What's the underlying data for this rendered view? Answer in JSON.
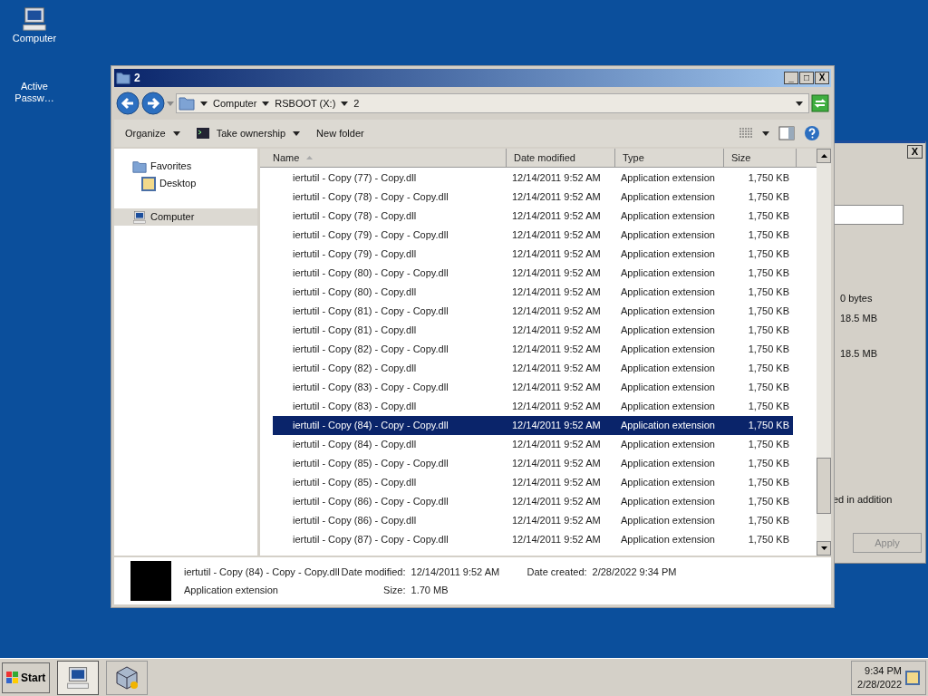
{
  "desktop_icons": [
    {
      "label": "Computer",
      "kind": "computer"
    },
    {
      "label": "Active Passw…",
      "kind": "blank"
    }
  ],
  "background_dialog": {
    "values": [
      "0 bytes",
      "18.5 MB",
      "18.5 MB"
    ],
    "note": "ed in addition",
    "apply_button": "Apply",
    "close_button": "X"
  },
  "window": {
    "title": "2",
    "controls": [
      "_",
      "□",
      "X"
    ]
  },
  "address_bar": {
    "breadcrumbs": [
      "Computer",
      "RSBOOT (X:)",
      "2"
    ]
  },
  "toolbar": [
    {
      "label": "Organize",
      "kind": "menu"
    },
    {
      "label": "Take ownership",
      "kind": "icon-menu"
    },
    {
      "label": "New folder",
      "kind": "plain"
    }
  ],
  "nav_pane": [
    {
      "label": "Favorites",
      "kind": "folder",
      "selected": false,
      "children": [
        {
          "label": "Desktop",
          "kind": "desktop",
          "selected": false
        }
      ]
    },
    {
      "label": "Computer",
      "kind": "computer",
      "selected": true
    }
  ],
  "table": {
    "columns": [
      "Name",
      "Date modified",
      "Type",
      "Size"
    ],
    "rows": [
      {
        "name": "iertutil - Copy (77) - Copy.dll",
        "date": "12/14/2011 9:52 AM",
        "type": "Application extension",
        "size": "1,750 KB",
        "selected": false
      },
      {
        "name": "iertutil - Copy (78) - Copy - Copy.dll",
        "date": "12/14/2011 9:52 AM",
        "type": "Application extension",
        "size": "1,750 KB",
        "selected": false
      },
      {
        "name": "iertutil - Copy (78) - Copy.dll",
        "date": "12/14/2011 9:52 AM",
        "type": "Application extension",
        "size": "1,750 KB",
        "selected": false
      },
      {
        "name": "iertutil - Copy (79) - Copy - Copy.dll",
        "date": "12/14/2011 9:52 AM",
        "type": "Application extension",
        "size": "1,750 KB",
        "selected": false
      },
      {
        "name": "iertutil - Copy (79) - Copy.dll",
        "date": "12/14/2011 9:52 AM",
        "type": "Application extension",
        "size": "1,750 KB",
        "selected": false
      },
      {
        "name": "iertutil - Copy (80) - Copy - Copy.dll",
        "date": "12/14/2011 9:52 AM",
        "type": "Application extension",
        "size": "1,750 KB",
        "selected": false
      },
      {
        "name": "iertutil - Copy (80) - Copy.dll",
        "date": "12/14/2011 9:52 AM",
        "type": "Application extension",
        "size": "1,750 KB",
        "selected": false
      },
      {
        "name": "iertutil - Copy (81) - Copy - Copy.dll",
        "date": "12/14/2011 9:52 AM",
        "type": "Application extension",
        "size": "1,750 KB",
        "selected": false
      },
      {
        "name": "iertutil - Copy (81) - Copy.dll",
        "date": "12/14/2011 9:52 AM",
        "type": "Application extension",
        "size": "1,750 KB",
        "selected": false
      },
      {
        "name": "iertutil - Copy (82) - Copy - Copy.dll",
        "date": "12/14/2011 9:52 AM",
        "type": "Application extension",
        "size": "1,750 KB",
        "selected": false
      },
      {
        "name": "iertutil - Copy (82) - Copy.dll",
        "date": "12/14/2011 9:52 AM",
        "type": "Application extension",
        "size": "1,750 KB",
        "selected": false
      },
      {
        "name": "iertutil - Copy (83) - Copy - Copy.dll",
        "date": "12/14/2011 9:52 AM",
        "type": "Application extension",
        "size": "1,750 KB",
        "selected": false
      },
      {
        "name": "iertutil - Copy (83) - Copy.dll",
        "date": "12/14/2011 9:52 AM",
        "type": "Application extension",
        "size": "1,750 KB",
        "selected": false
      },
      {
        "name": "iertutil - Copy (84) - Copy - Copy.dll",
        "date": "12/14/2011 9:52 AM",
        "type": "Application extension",
        "size": "1,750 KB",
        "selected": true
      },
      {
        "name": "iertutil - Copy (84) - Copy.dll",
        "date": "12/14/2011 9:52 AM",
        "type": "Application extension",
        "size": "1,750 KB",
        "selected": false
      },
      {
        "name": "iertutil - Copy (85) - Copy - Copy.dll",
        "date": "12/14/2011 9:52 AM",
        "type": "Application extension",
        "size": "1,750 KB",
        "selected": false
      },
      {
        "name": "iertutil - Copy (85) - Copy.dll",
        "date": "12/14/2011 9:52 AM",
        "type": "Application extension",
        "size": "1,750 KB",
        "selected": false
      },
      {
        "name": "iertutil - Copy (86) - Copy - Copy.dll",
        "date": "12/14/2011 9:52 AM",
        "type": "Application extension",
        "size": "1,750 KB",
        "selected": false
      },
      {
        "name": "iertutil - Copy (86) - Copy.dll",
        "date": "12/14/2011 9:52 AM",
        "type": "Application extension",
        "size": "1,750 KB",
        "selected": false
      },
      {
        "name": "iertutil - Copy (87) - Copy - Copy.dll",
        "date": "12/14/2011 9:52 AM",
        "type": "Application extension",
        "size": "1,750 KB",
        "selected": false
      }
    ]
  },
  "details_pane": {
    "name": "iertutil - Copy (84) - Copy - Copy.dll",
    "type": "Application extension",
    "fields": [
      {
        "label": "Date modified:",
        "value": "12/14/2011 9:52 AM"
      },
      {
        "label": "Size:",
        "value": "1.70 MB"
      },
      {
        "label": "Date created:",
        "value": "2/28/2022 9:34 PM"
      }
    ]
  },
  "taskbar": {
    "start_button": "Start",
    "items": [
      {
        "kind": "computer",
        "selected": true
      },
      {
        "kind": "box",
        "selected": false
      }
    ],
    "time": "9:34 PM",
    "date": "2/28/2022"
  }
}
